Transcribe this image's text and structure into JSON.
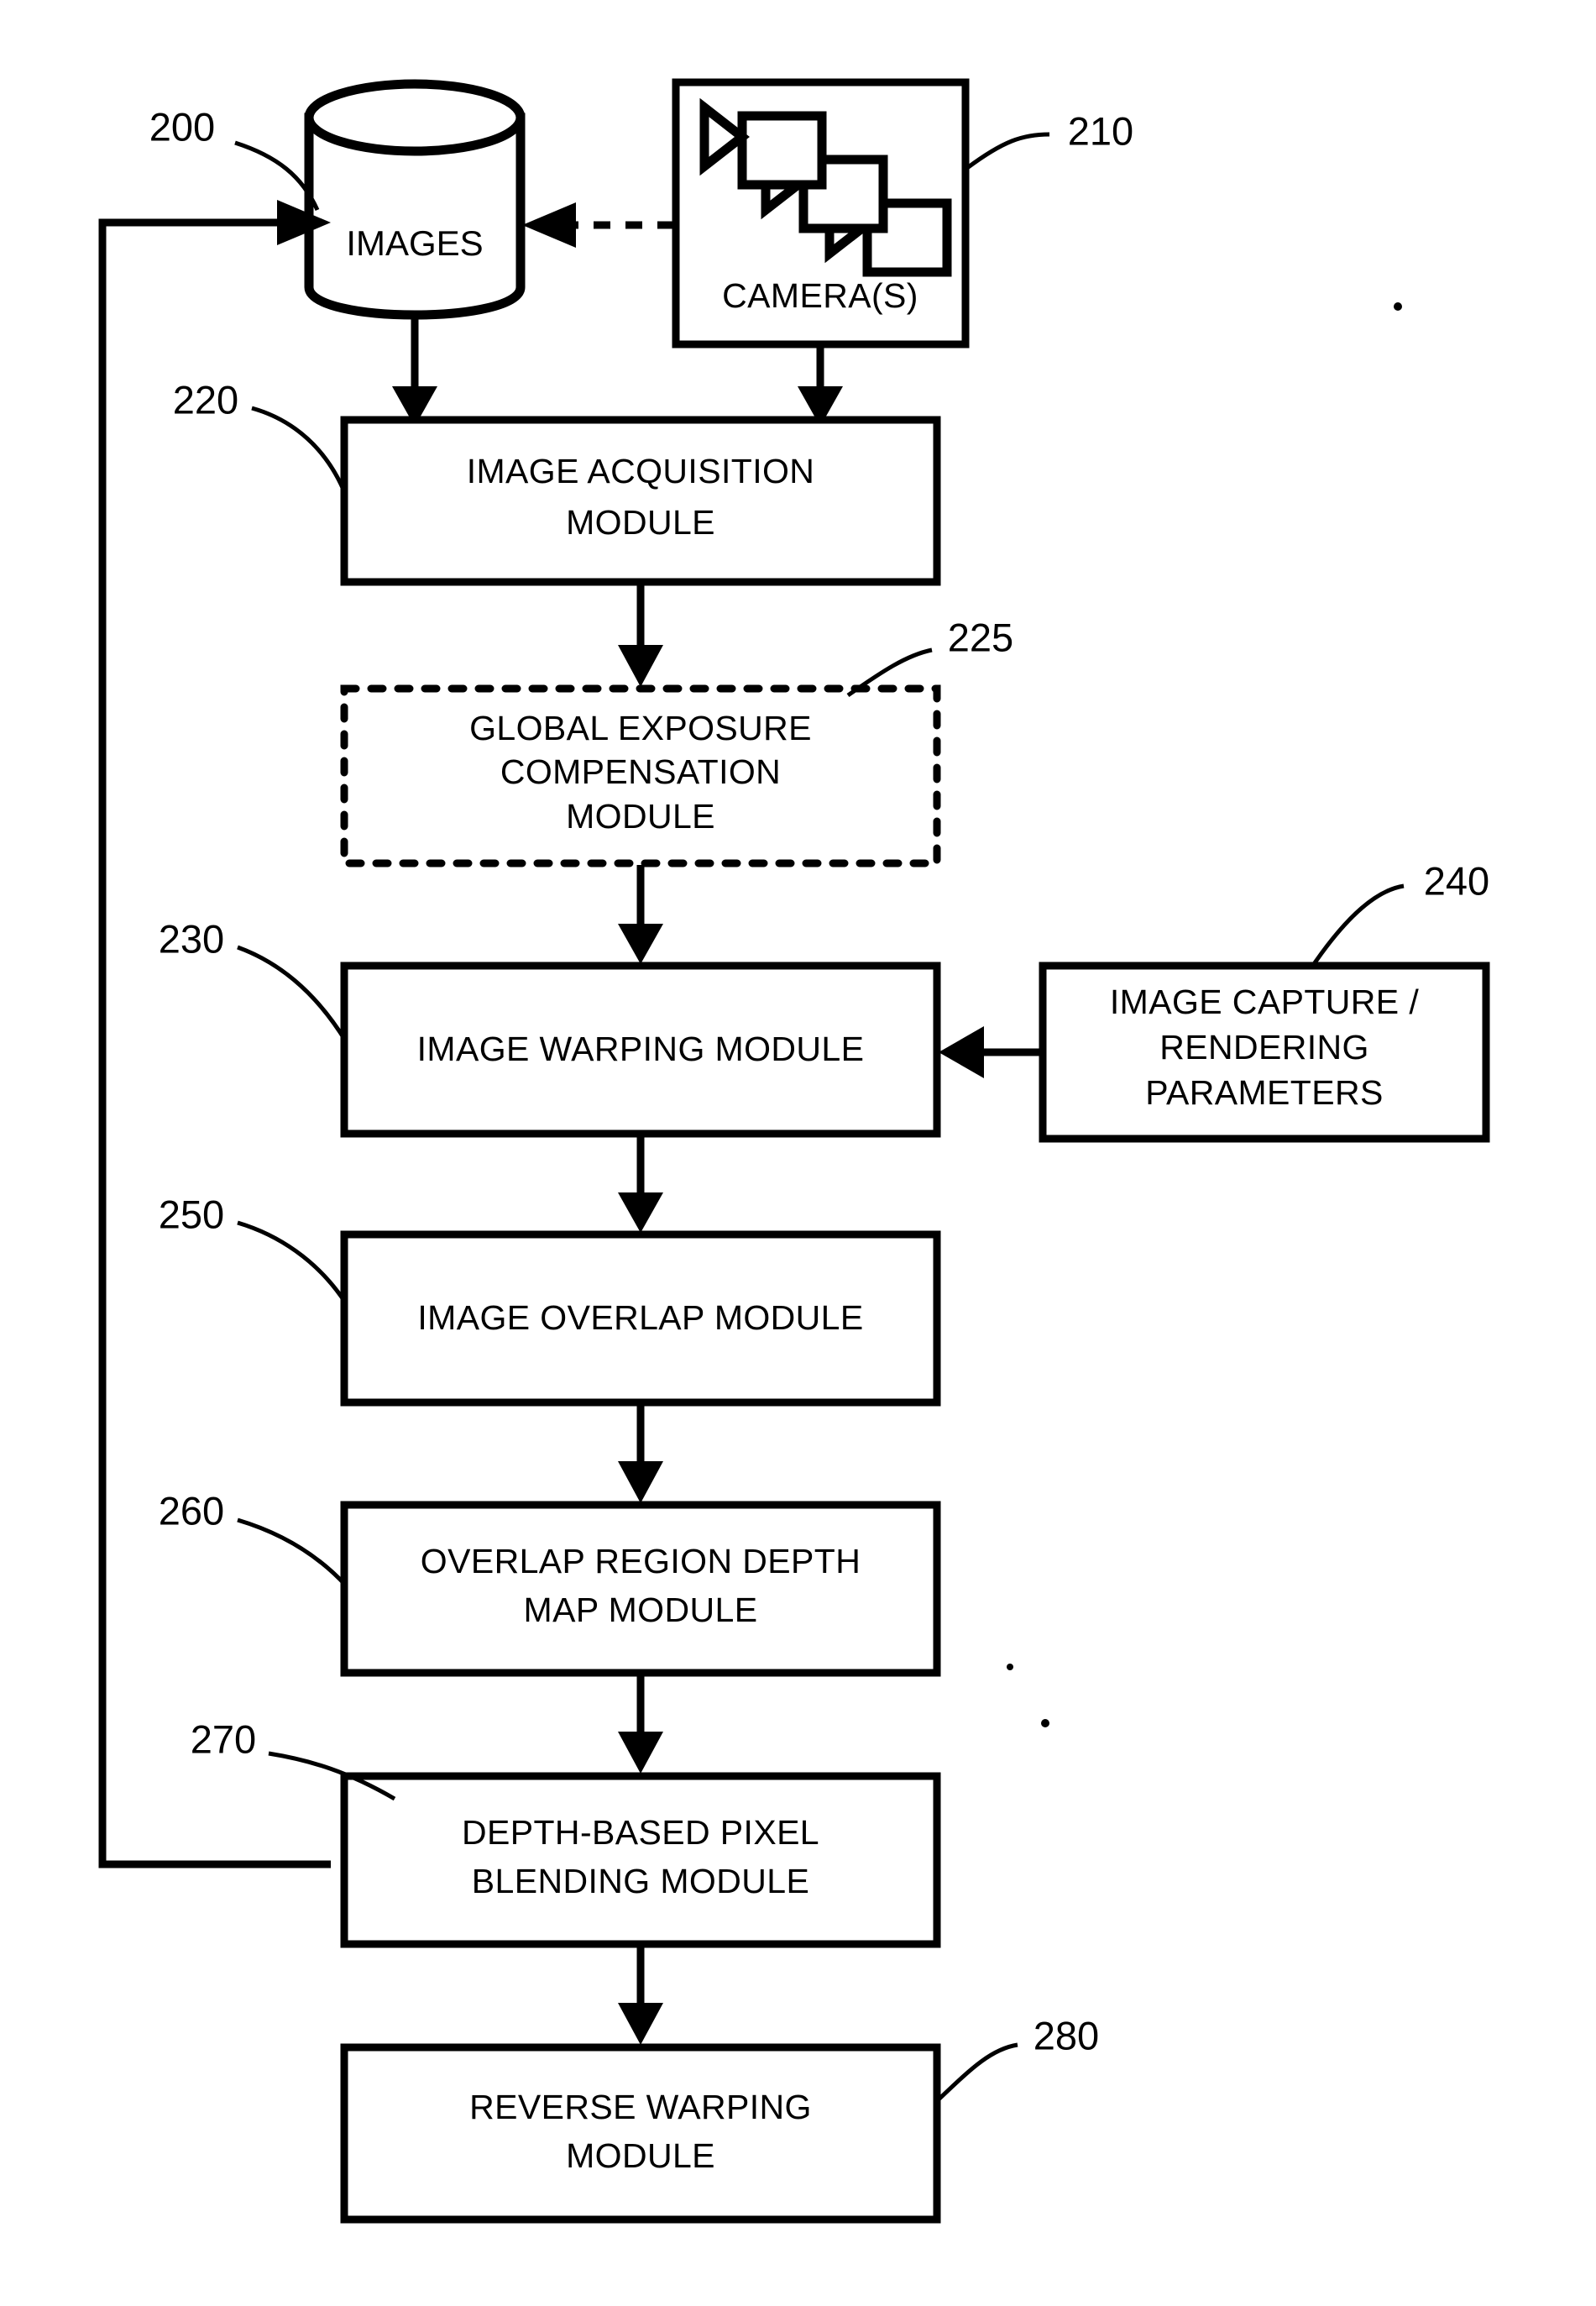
{
  "figure": {
    "type": "patent-flow-diagram",
    "background_color": "#ffffff",
    "line_color": "#000000"
  },
  "nodes": {
    "images_store": {
      "label": "IMAGES",
      "ref": "200",
      "shape": "cylinder",
      "border": "solid"
    },
    "cameras": {
      "label": "CAMERA(S)",
      "ref": "210",
      "shape": "rectangle",
      "border": "solid",
      "icon": "camera-stack-icon",
      "camera_count": 3
    },
    "image_acquisition": {
      "label_line1": "IMAGE ACQUISITION",
      "label_line2": "MODULE",
      "ref": "220",
      "shape": "rectangle",
      "border": "solid"
    },
    "global_exposure": {
      "label_line1": "GLOBAL EXPOSURE",
      "label_line2": "COMPENSATION",
      "label_line3": "MODULE",
      "ref": "225",
      "shape": "rectangle",
      "border": "dashed"
    },
    "image_warping": {
      "label_line1": "IMAGE WARPING MODULE",
      "ref": "230",
      "shape": "rectangle",
      "border": "solid"
    },
    "capture_params": {
      "label_line1": "IMAGE CAPTURE /",
      "label_line2": "RENDERING",
      "label_line3": "PARAMETERS",
      "ref": "240",
      "shape": "rectangle",
      "border": "solid"
    },
    "image_overlap": {
      "label_line1": "IMAGE OVERLAP MODULE",
      "ref": "250",
      "shape": "rectangle",
      "border": "solid"
    },
    "overlap_depth_map": {
      "label_line1": "OVERLAP REGION DEPTH",
      "label_line2": "MAP MODULE",
      "ref": "260",
      "shape": "rectangle",
      "border": "solid"
    },
    "depth_blending": {
      "label_line1": "DEPTH-BASED PIXEL",
      "label_line2": "BLENDING MODULE",
      "ref": "270",
      "shape": "rectangle",
      "border": "solid"
    },
    "reverse_warping": {
      "label_line1": "REVERSE WARPING",
      "label_line2": "MODULE",
      "ref": "280",
      "shape": "rectangle",
      "border": "solid"
    }
  },
  "edges": [
    {
      "from": "cameras",
      "to": "images_store",
      "style": "dashed",
      "direction": "left"
    },
    {
      "from": "images_store",
      "to": "image_acquisition",
      "style": "solid",
      "direction": "down"
    },
    {
      "from": "cameras",
      "to": "image_acquisition",
      "style": "solid",
      "direction": "down"
    },
    {
      "from": "image_acquisition",
      "to": "global_exposure",
      "style": "solid",
      "direction": "down"
    },
    {
      "from": "global_exposure",
      "to": "image_warping",
      "style": "solid",
      "direction": "down"
    },
    {
      "from": "capture_params",
      "to": "image_warping",
      "style": "solid",
      "direction": "left"
    },
    {
      "from": "image_warping",
      "to": "image_overlap",
      "style": "solid",
      "direction": "down"
    },
    {
      "from": "image_overlap",
      "to": "overlap_depth_map",
      "style": "solid",
      "direction": "down"
    },
    {
      "from": "overlap_depth_map",
      "to": "depth_blending",
      "style": "solid",
      "direction": "down"
    },
    {
      "from": "depth_blending",
      "to": "images_store",
      "style": "solid",
      "direction": "feedback-left-up"
    },
    {
      "from": "depth_blending",
      "to": "reverse_warping",
      "style": "solid",
      "direction": "down"
    }
  ]
}
